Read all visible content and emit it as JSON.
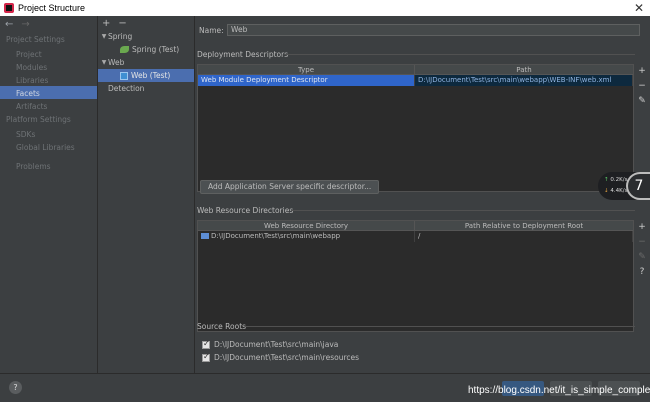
{
  "window": {
    "title": "Project Structure",
    "close_glyph": "✕"
  },
  "nav": {
    "back_glyph": "←",
    "forward_glyph": "→",
    "project_settings_header": "Project Settings",
    "project_settings": [
      "Project",
      "Modules",
      "Libraries",
      "Facets",
      "Artifacts"
    ],
    "selected": "Facets",
    "platform_settings_header": "Platform Settings",
    "platform_settings": [
      "SDKs",
      "Global Libraries"
    ],
    "problems": "Problems"
  },
  "tree": {
    "add_glyph": "+",
    "remove_glyph": "−",
    "spring_group": "Spring",
    "spring_item": "Spring (Test)",
    "web_group": "Web",
    "web_item": "Web (Test)",
    "detection": "Detection"
  },
  "facet": {
    "name_label": "Name:",
    "name_value": "Web",
    "deployment_descriptors_title": "Deployment Descriptors",
    "dd_columns": [
      "Type",
      "Path"
    ],
    "dd_rows": [
      {
        "type": "Web Module Deployment Descriptor",
        "path": "D:\\IJDocument\\Test\\src\\main\\webapp\\WEB-INF\\web.xml"
      }
    ],
    "add_server_descriptor_button": "Add Application Server specific descriptor...",
    "web_resource_title": "Web Resource Directories",
    "wr_columns": [
      "Web Resource Directory",
      "Path Relative to Deployment Root"
    ],
    "wr_rows": [
      {
        "dir": "D:\\IJDocument\\Test\\src\\main\\webapp",
        "relpath": "/"
      }
    ],
    "source_roots_title": "Source Roots",
    "source_roots": [
      "D:\\IJDocument\\Test\\src\\main\\java",
      "D:\\IJDocument\\Test\\src\\main\\resources"
    ]
  },
  "tools": {
    "add": "+",
    "remove": "−",
    "edit": "✎",
    "help": "?"
  },
  "net_widget": {
    "up": "0.2K/s",
    "down": "4.4K/s",
    "big": "7"
  },
  "bottom": {
    "help_glyph": "?",
    "watermark": "https://blog.csdn.net/it_is_simple_complex"
  },
  "colors": {
    "selection": "#4b6eaf",
    "background": "#3c3f41",
    "table_bg": "#2b2b2b"
  }
}
